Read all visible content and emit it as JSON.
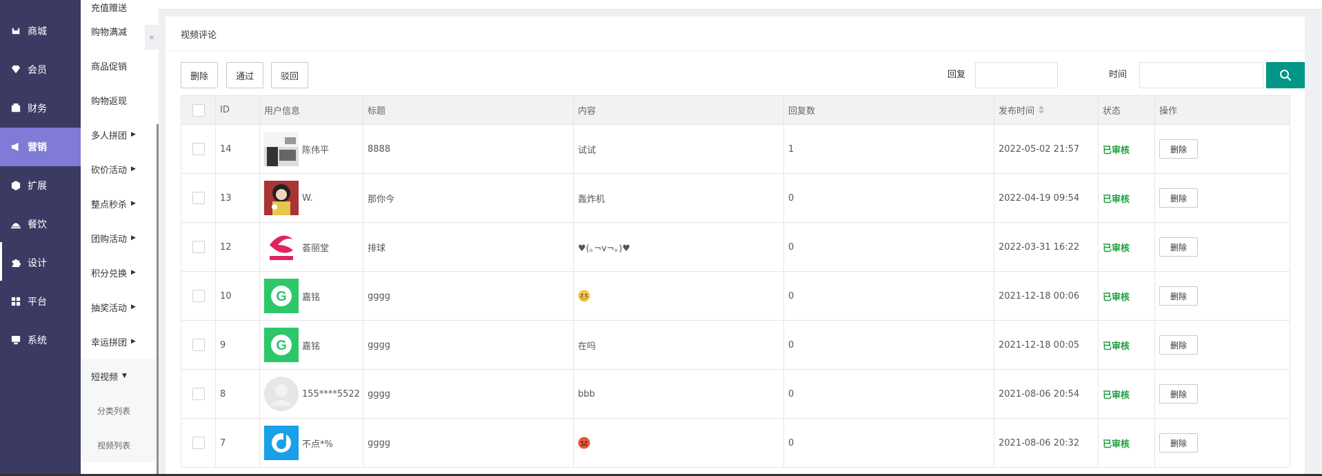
{
  "sidebar": {
    "items": [
      {
        "label": "商城",
        "icon": "shop-icon"
      },
      {
        "label": "会员",
        "icon": "gem-icon"
      },
      {
        "label": "财务",
        "icon": "wallet-icon"
      },
      {
        "label": "营销",
        "icon": "megaphone-icon"
      },
      {
        "label": "扩展",
        "icon": "cube-icon"
      },
      {
        "label": "餐饮",
        "icon": "food-icon"
      },
      {
        "label": "设计",
        "icon": "puzzle-icon"
      },
      {
        "label": "平台",
        "icon": "grid-icon"
      },
      {
        "label": "系统",
        "icon": "monitor-icon"
      }
    ],
    "active_index": 3
  },
  "submenu": {
    "items": [
      {
        "label": "充值赠送",
        "has_arrow": false
      },
      {
        "label": "购物满减",
        "has_arrow": false
      },
      {
        "label": "商品促销",
        "has_arrow": false
      },
      {
        "label": "购物返现",
        "has_arrow": false
      },
      {
        "label": "多人拼团",
        "has_arrow": true
      },
      {
        "label": "砍价活动",
        "has_arrow": true
      },
      {
        "label": "整点秒杀",
        "has_arrow": true
      },
      {
        "label": "团购活动",
        "has_arrow": true
      },
      {
        "label": "积分兑换",
        "has_arrow": true
      },
      {
        "label": "抽奖活动",
        "has_arrow": true
      },
      {
        "label": "幸运拼团",
        "has_arrow": true
      },
      {
        "label": "短视频",
        "has_arrow": true,
        "open": true
      }
    ],
    "children": [
      "分类列表",
      "视频列表"
    ]
  },
  "collapse_icon": "«",
  "panel": {
    "title": "视频评论"
  },
  "toolbar": {
    "delete_label": "删除",
    "approve_label": "通过",
    "reject_label": "驳回",
    "reply_label": "回复",
    "reply_value": "",
    "time_label": "时间",
    "time_value": ""
  },
  "table": {
    "headers": [
      "ID",
      "用户信息",
      "标题",
      "内容",
      "回复数",
      "发布时间",
      "状态",
      "操作"
    ],
    "rows": [
      {
        "id": "14",
        "user": "陈伟平",
        "avatar": "photo",
        "title": "8888",
        "content": "试试",
        "replies": "1",
        "time": "2022-05-02 21:57",
        "status": "已审核",
        "action": "删除"
      },
      {
        "id": "13",
        "user": "W.",
        "avatar": "girl",
        "title": "那你今",
        "content": "轰炸机",
        "replies": "0",
        "time": "2022-04-19 09:54",
        "status": "已审核",
        "action": "删除"
      },
      {
        "id": "12",
        "user": "荟丽堂",
        "avatar": "logo-red",
        "title": "排球",
        "content": "♥(｡¬v¬｡)♥",
        "replies": "0",
        "time": "2022-03-31 16:22",
        "status": "已审核",
        "action": "删除"
      },
      {
        "id": "10",
        "user": "嘉铭",
        "avatar": "logo-green",
        "title": "gggg",
        "content": "",
        "content_emoji": "grin",
        "replies": "0",
        "time": "2021-12-18 00:06",
        "status": "已审核",
        "action": "删除"
      },
      {
        "id": "9",
        "user": "嘉铭",
        "avatar": "logo-green",
        "title": "gggg",
        "content": "在吗",
        "replies": "0",
        "time": "2021-12-18 00:05",
        "status": "已审核",
        "action": "删除"
      },
      {
        "id": "8",
        "user": "155****5522",
        "avatar": "default",
        "title": "gggg",
        "content": "bbb",
        "replies": "0",
        "time": "2021-08-06 20:54",
        "status": "已审核",
        "action": "删除"
      },
      {
        "id": "7",
        "user": "不点*%",
        "avatar": "logo-blue",
        "title": "gggg",
        "content": "",
        "content_emoji": "angry",
        "replies": "0",
        "time": "2021-08-06 20:32",
        "status": "已审核",
        "action": "删除"
      }
    ]
  },
  "colors": {
    "sidebar_bg": "#3b3a63",
    "active": "#7f7bd6",
    "primary": "#009688",
    "status": "#1e9e3e"
  }
}
